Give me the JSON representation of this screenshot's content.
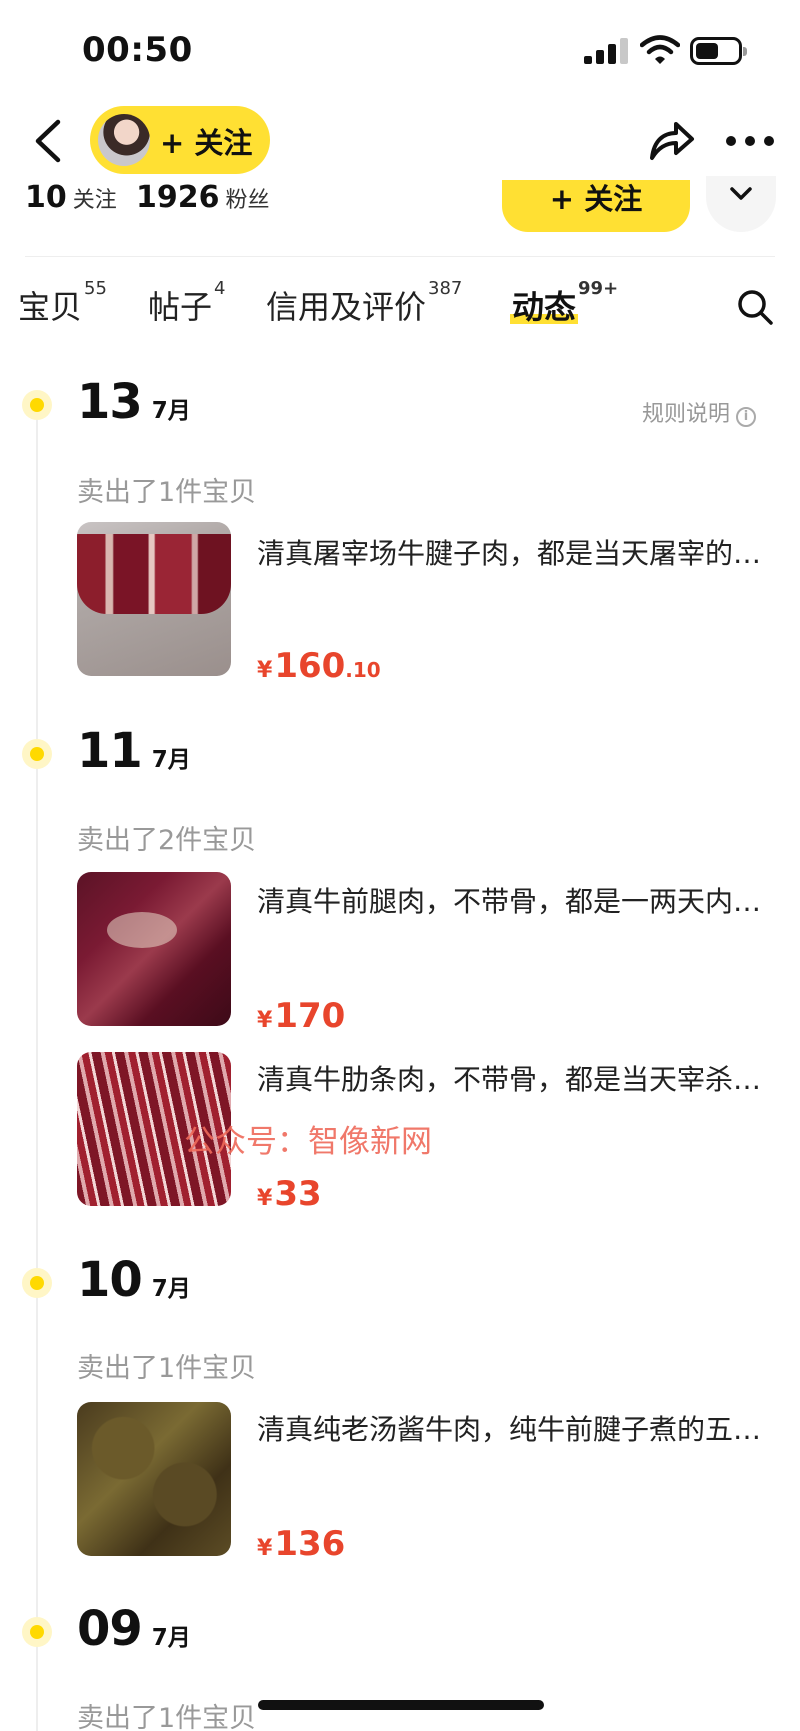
{
  "status_bar": {
    "time": "00:50"
  },
  "header": {
    "follow_label": "+ 关注"
  },
  "stats": {
    "following_count": "10",
    "following_label": "关注",
    "fans_count": "1926",
    "fans_label": "粉丝",
    "follow_button": "+ 关注"
  },
  "tabs": [
    {
      "label": "宝贝",
      "count": "55"
    },
    {
      "label": "帖子",
      "count": "4"
    },
    {
      "label": "信用及评价",
      "count": "387"
    },
    {
      "label": "动态",
      "count": "99+",
      "active": true
    }
  ],
  "rules_label": "规则说明",
  "timeline": [
    {
      "day": "13",
      "month": "7月",
      "sold": "卖出了1件宝贝",
      "items": [
        {
          "title": "清真屠宰场牛腱子肉，都是当天屠宰的新鲜货",
          "price_int": "160",
          "price_dec": ".10"
        }
      ]
    },
    {
      "day": "11",
      "month": "7月",
      "sold": "卖出了2件宝贝",
      "items": [
        {
          "title": "清真牛前腿肉，不带骨，都是一两天内宰杀的",
          "price_int": "170"
        },
        {
          "title": "清真牛肋条肉，不带骨，都是当天宰杀的新鲜肉",
          "price_int": "33"
        }
      ]
    },
    {
      "day": "10",
      "month": "7月",
      "sold": "卖出了1件宝贝",
      "items": [
        {
          "title": "清真纯老汤酱牛肉，纯牛前腱子煮的五香味",
          "price_int": "136"
        }
      ]
    },
    {
      "day": "09",
      "month": "7月",
      "sold": "卖出了1件宝贝"
    }
  ],
  "currency": "¥",
  "watermark": "公众号：智像新网",
  "colors": {
    "accent_yellow": "#ffe033",
    "price_red": "#e8452c"
  }
}
